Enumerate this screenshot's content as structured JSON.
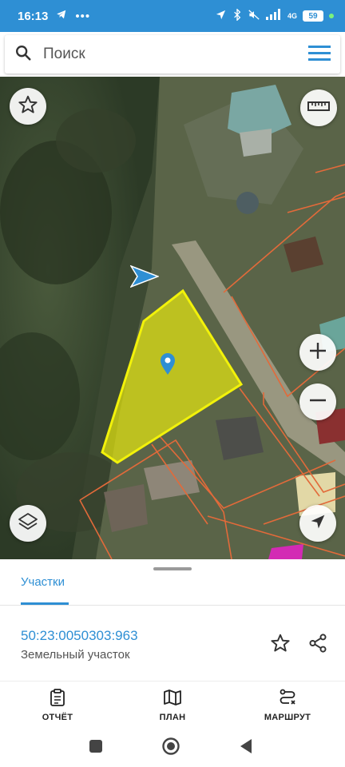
{
  "status": {
    "time": "16:13",
    "battery": "59",
    "network": "4G"
  },
  "search": {
    "placeholder": "Поиск"
  },
  "map": {
    "buttons": [
      "favorite",
      "ruler",
      "layers",
      "zoom-in",
      "zoom-out",
      "my-location"
    ],
    "parcel_color": "#f2f20a",
    "boundary_color": "#e26a3a"
  },
  "sheet": {
    "tab_label": "Участки",
    "cadastral_number": "50:23:0050303:963",
    "parcel_type": "Земельный участок"
  },
  "nav": {
    "report_label": "ОТЧЁТ",
    "plan_label": "ПЛАН",
    "route_label": "МАРШРУТ"
  },
  "colors": {
    "accent": "#2e8fd4"
  }
}
